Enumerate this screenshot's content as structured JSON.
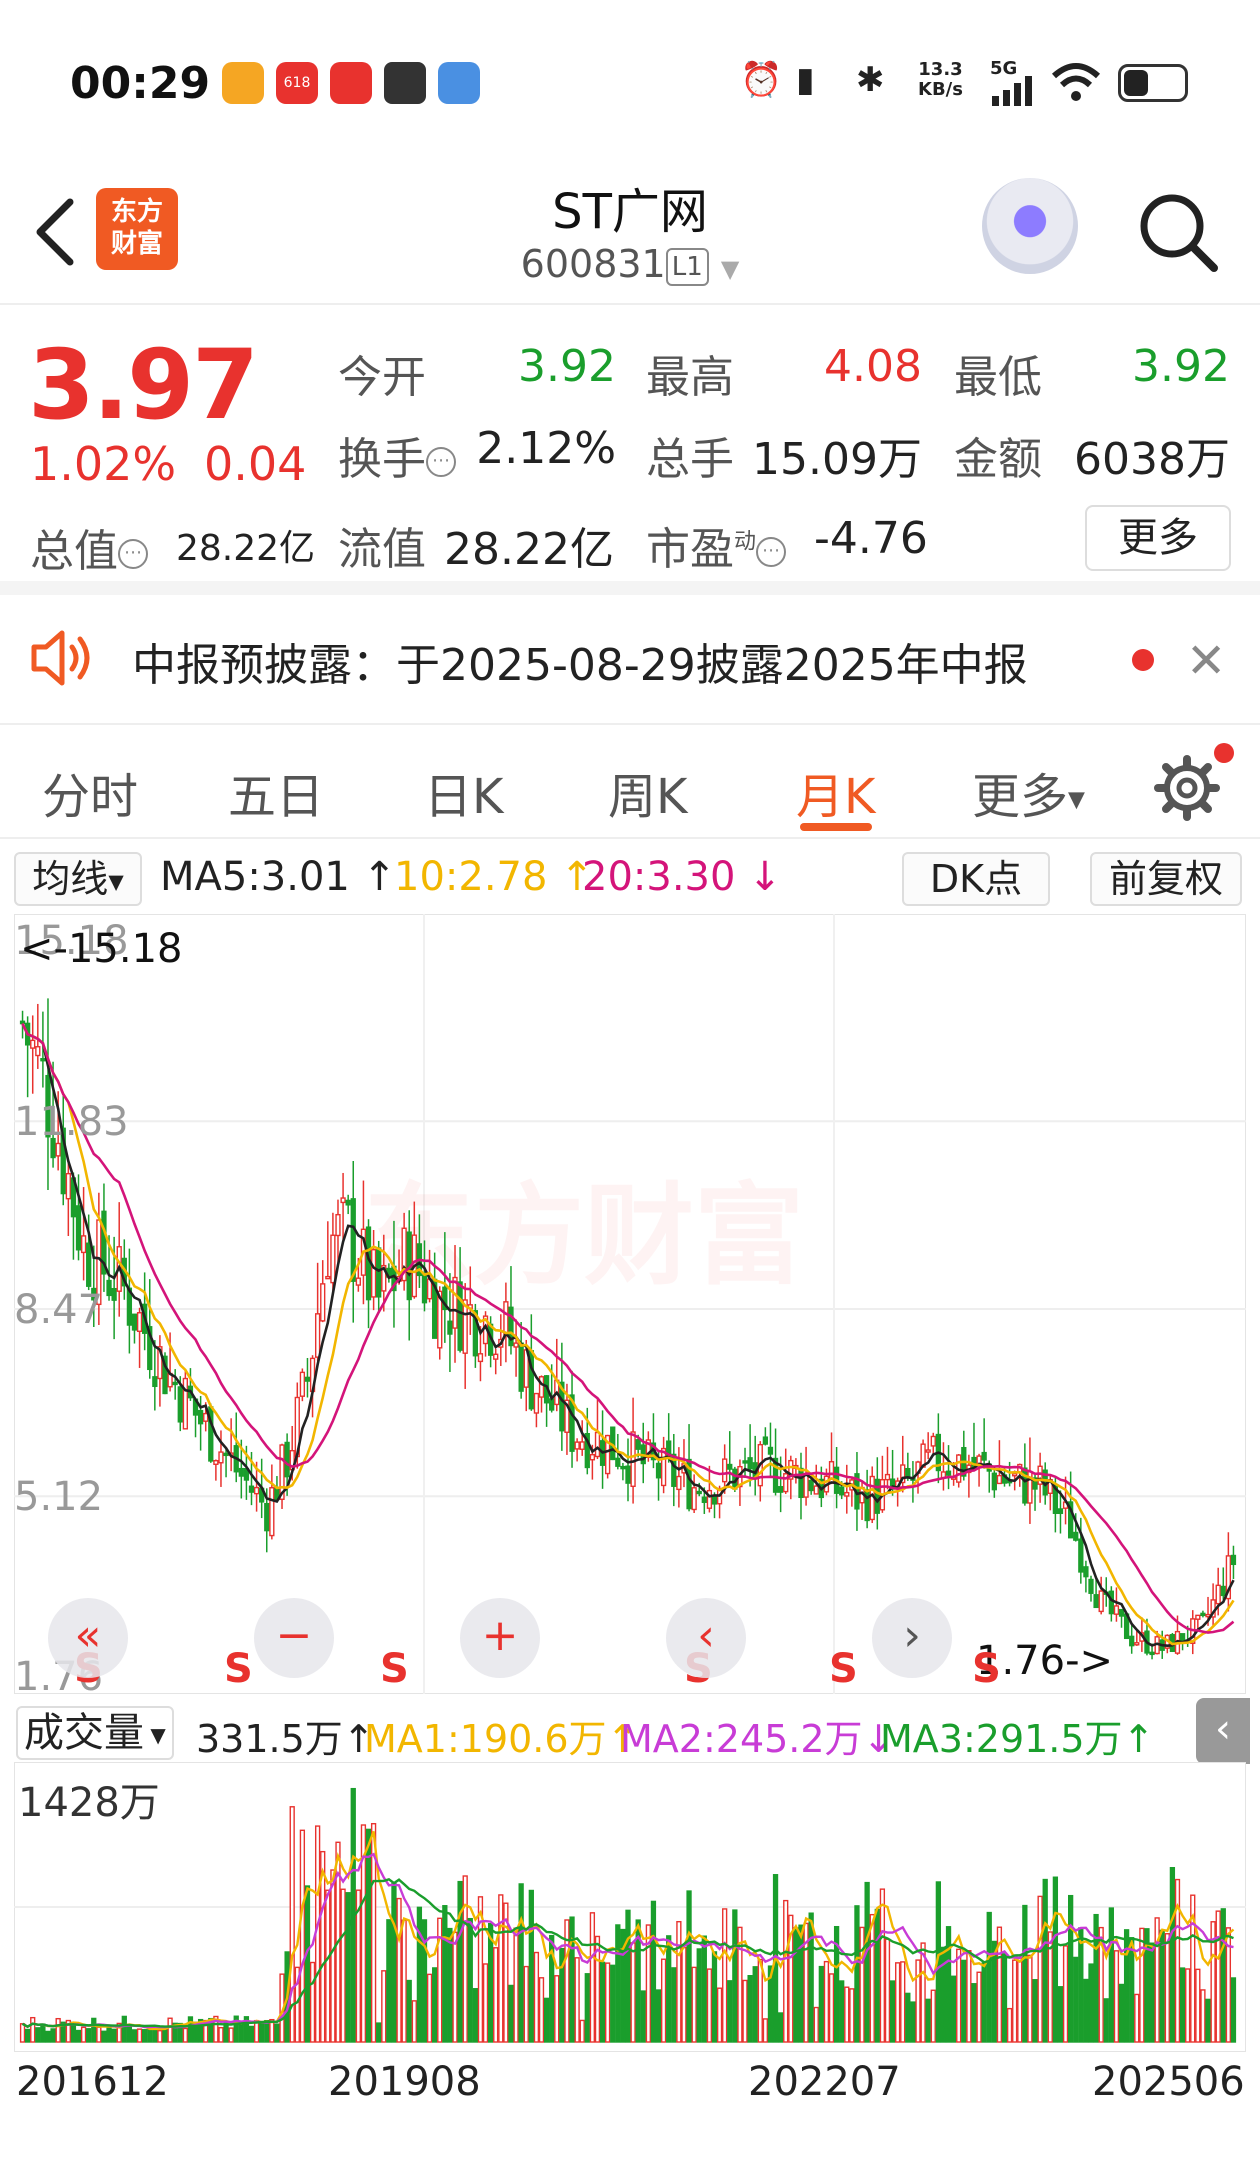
{
  "status_bar": {
    "time": "00:29",
    "net_speed_value": "13.3",
    "net_speed_unit": "KB/s",
    "signal_label": "5G",
    "app_badge_618": "618"
  },
  "header": {
    "logo_line1": "东方",
    "logo_line2": "财富",
    "stock_name": "ST广网",
    "stock_code": "600831",
    "level_badge": "L1"
  },
  "quote": {
    "price": "3.97",
    "change_pct": "1.02%",
    "change_abs": "0.04",
    "open_label": "今开",
    "open_value": "3.92",
    "high_label": "最高",
    "high_value": "4.08",
    "low_label": "最低",
    "low_value": "3.92",
    "turnover_label": "换手",
    "turnover_value": "2.12%",
    "volume_label": "总手",
    "volume_value": "15.09万",
    "amount_label": "金额",
    "amount_value": "6038万",
    "mktcap_label": "总值",
    "mktcap_value": "28.22亿",
    "float_label": "流值",
    "float_value": "28.22亿",
    "pe_label": "市盈",
    "pe_sup": "动",
    "pe_value": "-4.76",
    "more_label": "更多"
  },
  "notice": {
    "text": "中报预披露：于2025-08-29披露2025年中报",
    "close_glyph": "✕"
  },
  "tabs": [
    {
      "label": "分时"
    },
    {
      "label": "五日"
    },
    {
      "label": "日K"
    },
    {
      "label": "周K"
    },
    {
      "label": "月K"
    },
    {
      "label": "更多"
    }
  ],
  "ma_bar": {
    "indicator_select": "均线",
    "ma5": "MA5:3.01",
    "ma10": "10:2.78",
    "ma20": "20:3.30",
    "dk_label": "DK点",
    "adjust_label": "前复权"
  },
  "chart_data": {
    "type": "candlestick",
    "y_ticks": [
      "15.18",
      "11.83",
      "8.47",
      "5.12",
      "1.76"
    ],
    "ylim": [
      1.76,
      15.18
    ],
    "max_label": "<-15.18",
    "min_label": "1.76->",
    "signal_label": "S",
    "x_ticks": [
      "201612",
      "201908",
      "202207",
      "202506"
    ],
    "ma_colors": {
      "MA5": "#222222",
      "MA10": "#f2b600",
      "MA20": "#d4147a"
    },
    "up_color": "#e8322e",
    "down_color": "#1a9e2c"
  },
  "volume": {
    "select_label": "成交量",
    "current": "331.5万",
    "ma1": "MA1:190.6万",
    "ma2": "MA2:245.2万",
    "ma3": "MA3:291.5万",
    "max_label": "1428万"
  },
  "floating_controls": {
    "rewind": "«",
    "zoom_out": "−",
    "zoom_in": "+",
    "prev": "‹",
    "next": "›"
  }
}
